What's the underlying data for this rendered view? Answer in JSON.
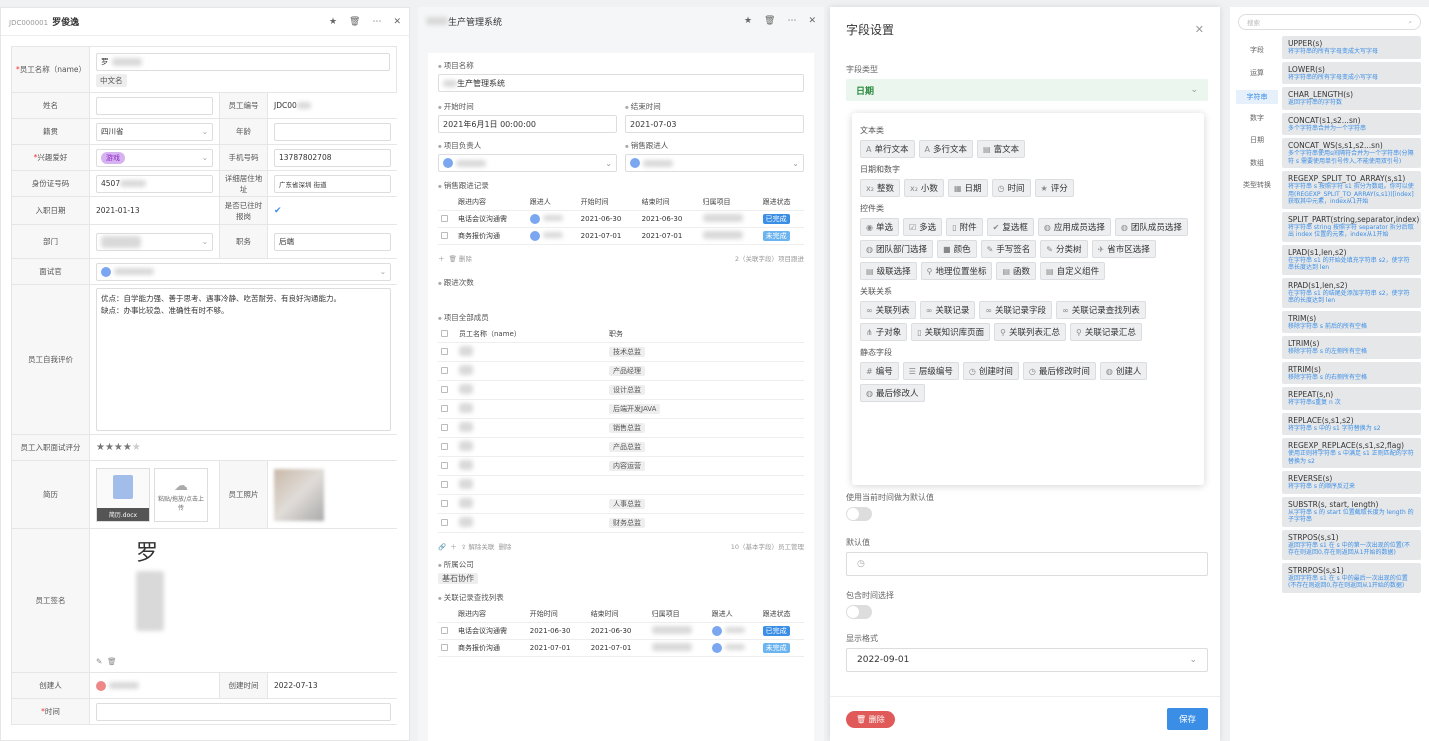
{
  "p1": {
    "code": "JDC000001",
    "name": "罗俊逸",
    "rows": {
      "emp_name_label": "员工名称（name）",
      "emp_name_val": "罗",
      "emp_name_hint": "中文名",
      "xm_label": "姓名",
      "empno_label": "员工编号",
      "empno_val": "JDC00",
      "jg_label": "籍贯",
      "jg_val": "四川省",
      "age_label": "年龄",
      "hobby_label": "兴趣爱好",
      "hobby_tag": "游戏",
      "phone_label": "手机号码",
      "phone_val": "13787802708",
      "id_label": "身份证号码",
      "id_val": "4507",
      "addr_label": "详细居住地址",
      "addr_val": "广东省深圳 街道",
      "join_label": "入职日期",
      "join_val": "2021-01-13",
      "ontime_label": "是否已往时报岗",
      "dept_label": "部门",
      "post_label": "职务",
      "post_val": "后端",
      "iv_label": "面试官",
      "eval_label": "员工自我评价",
      "eval_l1": "优点：自学能力强、善于思考、遇事冷静、吃苦耐劳、有良好沟通能力。",
      "eval_l2": "缺点：办事比较急、准确性有时不够。",
      "score_label": "员工入职面试评分",
      "resume_label": "简历",
      "resume_file": "简历.docx",
      "upload_hint": "粘贴/拖放/点击上传",
      "photo_label": "员工照片",
      "sign_label": "员工签名",
      "creator_label": "创建人",
      "ctime_label": "创建时间",
      "ctime_val": "2022-07-13",
      "time_label": "时间"
    }
  },
  "p2": {
    "title": "生产管理系统",
    "proj_label": "项目名称",
    "proj_val": "生产管理系统",
    "start_label": "开始时间",
    "start_val": "2021年6月1日 00:00:00",
    "end_label": "结束时间",
    "end_val": "2021-07-03",
    "owner_label": "项目负责人",
    "sales_label": "销售跟进人",
    "rec_label": "销售跟进记录",
    "rec_head": [
      "跟进内容",
      "跟进人",
      "开始时间",
      "结束时间",
      "归属项目",
      "跟进状态"
    ],
    "rec_rows": [
      [
        "电话会议沟通需",
        "2021-06-30",
        "2021-06-30",
        "已完成"
      ],
      [
        "商务报价沟通",
        "2021-07-01",
        "2021-07-01",
        "未完成"
      ]
    ],
    "rec_del": "删除",
    "rec_foot": "2（关联字段）项目跟进",
    "cnt_label": "跟进次数",
    "mem_label": "项目全部成员",
    "mem_head": [
      "员工名称（name）",
      "职务"
    ],
    "mem_posts": [
      "技术总监",
      "产品经理",
      "设计总监",
      "后端开发JAVA",
      "销售总监",
      "产品总监",
      "内容运营",
      "",
      "人事总监",
      "财务总监"
    ],
    "mem_actions": [
      "解除关联",
      "删除"
    ],
    "mem_foot": "10（基本字段）员工管理",
    "co_label": "所属公司",
    "co_val": "基石协作",
    "find_label": "关联记录查找列表",
    "find_head": [
      "跟进内容",
      "开始时间",
      "结束时间",
      "归属项目",
      "跟进人",
      "跟进状态"
    ],
    "find_rows": [
      [
        "电话会议沟通需",
        "2021-06-30",
        "2021-06-30",
        "已完成"
      ],
      [
        "商务报价沟通",
        "2021-07-01",
        "2021-07-01",
        "未完成"
      ]
    ]
  },
  "p3": {
    "title": "字段设置",
    "type_label": "字段类型",
    "type_val": "日期",
    "groups": [
      {
        "title": "文本类",
        "items": [
          [
            "A",
            "单行文本"
          ],
          [
            "A",
            "多行文本"
          ],
          [
            "▤",
            "富文本"
          ]
        ]
      },
      {
        "title": "日期和数字",
        "items": [
          [
            "x₂",
            "整数"
          ],
          [
            "x₂",
            "小数"
          ],
          [
            "▦",
            "日期"
          ],
          [
            "◷",
            "时间"
          ],
          [
            "★",
            "评分"
          ]
        ]
      },
      {
        "title": "控件类",
        "items": [
          [
            "◉",
            "单选"
          ],
          [
            "☑",
            "多选"
          ],
          [
            "▯",
            "附件"
          ],
          [
            "✔",
            "复选框"
          ],
          [
            "◍",
            "应用成员选择"
          ],
          [
            "◍",
            "团队成员选择"
          ],
          [
            "◍",
            "团队部门选择"
          ],
          [
            "■",
            "颜色"
          ],
          [
            "✎",
            "手写签名"
          ],
          [
            "✎",
            "分类树"
          ],
          [
            "✈",
            "省市区选择"
          ],
          [
            "▤",
            "级联选择"
          ],
          [
            "⚲",
            "地理位置坐标"
          ],
          [
            "▤",
            "函数"
          ],
          [
            "▤",
            "自定义组件"
          ]
        ]
      },
      {
        "title": "关联关系",
        "items": [
          [
            "∞",
            "关联列表"
          ],
          [
            "∞",
            "关联记录"
          ],
          [
            "∞",
            "关联记录字段"
          ],
          [
            "∞",
            "关联记录查找列表"
          ],
          [
            "⋔",
            "子对象"
          ],
          [
            "▯",
            "关联知识库页面"
          ],
          [
            "⚲",
            "关联列表汇总"
          ],
          [
            "⚲",
            "关联记录汇总"
          ]
        ]
      },
      {
        "title": "静态字段",
        "items": [
          [
            "#",
            "编号"
          ],
          [
            "☰",
            "层级编号"
          ],
          [
            "◷",
            "创建时间"
          ],
          [
            "◷",
            "最后修改时间"
          ],
          [
            "◍",
            "创建人"
          ],
          [
            "◍",
            "最后修改人"
          ]
        ]
      }
    ],
    "now_default_label": "使用当前时间做为默认值",
    "default_label": "默认值",
    "incl_time_label": "包含时间选择",
    "fmt_label": "显示格式",
    "fmt_val": "2022-09-01",
    "del_btn": "删除",
    "save_btn": "保存"
  },
  "p4": {
    "search": "搜索",
    "cats": [
      "字段",
      "运算",
      "字符串",
      "数字",
      "日期",
      "数组",
      "类型转换"
    ],
    "fns": [
      [
        "UPPER(s)",
        "将字符串的所有字母变成大写字母"
      ],
      [
        "LOWER(s)",
        "将字符串的所有字母变成小写字母"
      ],
      [
        "CHAR_LENGTH(s)",
        "返回字符串的字符数"
      ],
      [
        "CONCAT(s1,s2...sn)",
        "多个字符串合并为一个字符串"
      ],
      [
        "CONCAT_WS(s,s1,s2...sn)",
        "多个字符串使用s间隔符合并为一个字符串(分隔符 s 需要使用单引号传入,不能使用双引号)"
      ],
      [
        "REGEXP_SPLIT_TO_ARRAY(s,s1)",
        "将字符串 s 按照字符 s1 拆分为数组。你可以使用(REGEXP_SPLIT_TO_ARRAY(s,s1))[index]获取其中元素，index从1开始"
      ],
      [
        "SPLIT_PART(string,separator,index)",
        "将字符串 string 按照字符 separator 拆分后取出 index 位置的元素，index从1开始"
      ],
      [
        "LPAD(s1,len,s2)",
        "在字符串 s1 的开始处填充字符串 s2，使字符串长度达到 len"
      ],
      [
        "RPAD(s1,len,s2)",
        "在字符串 s1 的结尾处添加字符串 s2，使字符串的长度达到 len"
      ],
      [
        "TRIM(s)",
        "移除字符串 s 前后的所有空格"
      ],
      [
        "LTRIM(s)",
        "移除字符串 s 的左侧所有空格"
      ],
      [
        "RTRIM(s)",
        "移除字符串 s 的右侧所有空格"
      ],
      [
        "REPEAT(s,n)",
        "将字符串s重复 n 次"
      ],
      [
        "REPLACE(s,s1,s2)",
        "将字符串 s 中的 s1 字符替换为 s2"
      ],
      [
        "REGEXP_REPLACE(s,s1,s2,flag)",
        "使用正则将字符串 s 中满足 s1 正则匹配的字符替换为 s2"
      ],
      [
        "REVERSE(s)",
        "将字符串 s 的顺序反过来"
      ],
      [
        "SUBSTR(s, start, length)",
        "从字符串 s 的 start 位置截取长度为 length 的子字符串"
      ],
      [
        "STRPOS(s,s1)",
        "返回字符串 s1 在 s 中的第一次出现的位置(不存在则返回0,存在则返回从1开始的数据)"
      ],
      [
        "STRRPOS(s,s1)",
        "返回字符串 s1 在 s 中的最后一次出现的位置(不存在则返回0,存在则返回从1开始的数据)"
      ]
    ]
  }
}
